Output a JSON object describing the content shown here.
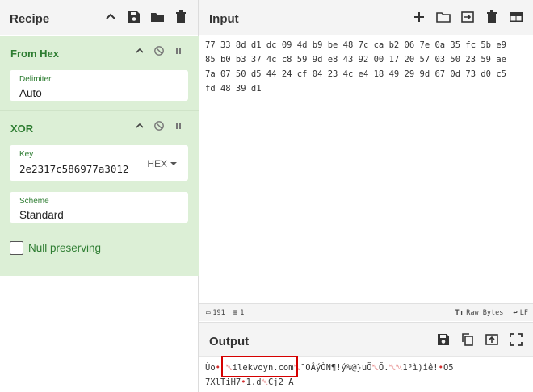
{
  "recipe": {
    "title": "Recipe",
    "operations": [
      {
        "name": "From Hex",
        "fields": [
          {
            "label": "Delimiter",
            "value": "Auto"
          }
        ]
      },
      {
        "name": "XOR",
        "key_label": "Key",
        "key_value": "2e2317c586977a3012",
        "key_format": "HEX",
        "scheme_label": "Scheme",
        "scheme_value": "Standard",
        "null_preserving_label": "Null preserving"
      }
    ]
  },
  "input": {
    "title": "Input",
    "lines": [
      "77 33 8d d1 dc 09 4d b9 be 48 7c ca b2 06 7e 0a 35 fc 5b e9",
      "85 b0 b3 37 4c c8 59 9d e8 43 92 00 17 20 57 03 50 23 59 ae",
      "7a 07 50 d5 44 24 cf 04 23 4c e4 18 49 29 9d 67 0d 73 d0 c5",
      "fd 48 39 d1"
    ],
    "status": {
      "length": "191",
      "lines": "1",
      "raw_bytes": "Raw Bytes",
      "eol": "LF"
    }
  },
  "output": {
    "title": "Output",
    "line1_a": "Ùo",
    "line1_b": "ilekvoyn.com",
    "line1_c": "¯OÂýÒN¶!ý%@}uÕ",
    "line1_d": "Õ.",
    "line1_e": "1³ì)îê!",
    "line1_f": "O5",
    "line2_a": "7XlTiH7",
    "line2_b": "1.d",
    "line2_c": "Cj2 A"
  },
  "colors": {
    "operation_bg": "#dcefd6",
    "operation_text": "#2e7d32",
    "highlight": "#d50000"
  }
}
